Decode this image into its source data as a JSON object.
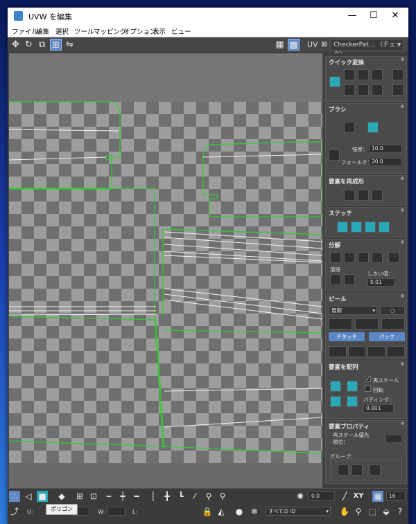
{
  "window": {
    "title": "UVW を編集",
    "minimize": "—",
    "maximize": "☐",
    "close": "✕"
  },
  "menu": [
    "ファイル",
    "編集",
    "選択",
    "ツール",
    "マッピング",
    "オプション",
    "表示",
    "ビュー"
  ],
  "toolbar": {
    "uv_label": "UV",
    "texture_select": "CheckerPat... （チェック）"
  },
  "panel": {
    "quick_transform": {
      "title": "クイック変換"
    },
    "brush": {
      "title": "ブラシ",
      "strength_label": "強度：",
      "strength_value": "10.0",
      "falloff_label": "フォールオフ：",
      "falloff_value": "20.0"
    },
    "reshape": {
      "title": "要素を再成形"
    },
    "stitch": {
      "title": "ステッチ"
    },
    "explode": {
      "title": "分解",
      "weld_label": "溶接",
      "threshold_label": "しきい値：",
      "threshold_value": "0.01"
    },
    "peel": {
      "title": "ピール",
      "mode": "展開",
      "detach": "デタッチ",
      "pack": "パック"
    },
    "arrange": {
      "title": "要素を配列",
      "rescale_label": "再スケール",
      "rotate_label": "回転",
      "padding_label": "パディング：",
      "padding_value": "0.001"
    },
    "props": {
      "title": "要素プロパティ",
      "rescale_priority_label": "再スケール優先順位：",
      "groups_label": "グループ："
    }
  },
  "bottom": {
    "angle_value": "0.0",
    "xy_label": "XY",
    "grid_value": "16",
    "u_label": "U:",
    "w_label": "W:",
    "l_label": "L:",
    "id_select": "すべての ID",
    "tooltip": "ポリゴン"
  }
}
